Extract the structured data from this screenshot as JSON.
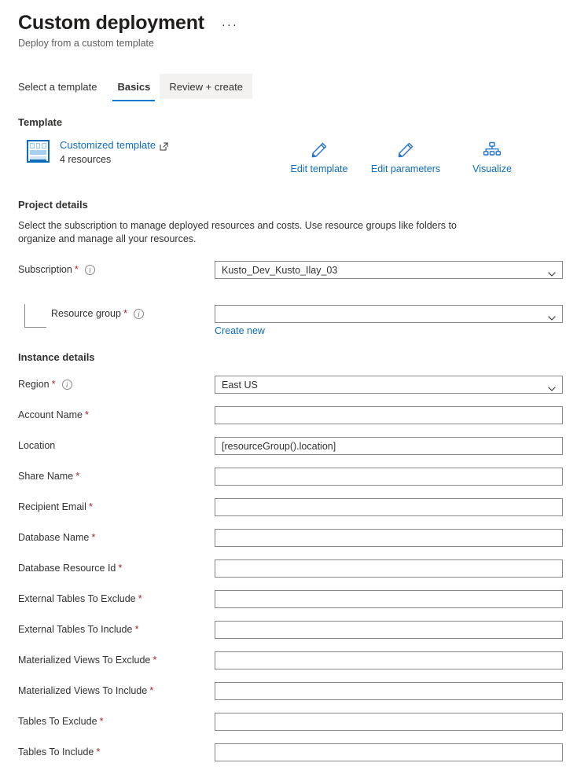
{
  "header": {
    "title": "Custom deployment",
    "subtitle": "Deploy from a custom template",
    "more_label": "···"
  },
  "tabs": [
    {
      "label": "Select a template",
      "state": "normal"
    },
    {
      "label": "Basics",
      "state": "selected"
    },
    {
      "label": "Review + create",
      "state": "hovered"
    }
  ],
  "template_section": {
    "heading": "Template",
    "link_label": "Customized template",
    "resources_label": "4 resources",
    "actions": [
      {
        "label": "Edit template",
        "icon": "pencil-icon"
      },
      {
        "label": "Edit parameters",
        "icon": "pencil-icon"
      },
      {
        "label": "Visualize",
        "icon": "hierarchy-icon"
      }
    ]
  },
  "project_details": {
    "heading": "Project details",
    "description": "Select the subscription to manage deployed resources and costs. Use resource groups like folders to organize and manage all your resources.",
    "subscription": {
      "label": "Subscription",
      "required": "*",
      "value": "Kusto_Dev_Kusto_Ilay_03",
      "has_info": true
    },
    "resource_group": {
      "label": "Resource group",
      "required": "*",
      "value": "",
      "has_info": true,
      "create_new_label": "Create new"
    }
  },
  "instance_details": {
    "heading": "Instance details",
    "fields": [
      {
        "label": "Region",
        "required": "*",
        "value": "East US",
        "type": "select",
        "has_info": true
      },
      {
        "label": "Account Name",
        "required": "*",
        "value": "",
        "type": "text",
        "has_info": false
      },
      {
        "label": "Location",
        "required": "",
        "value": "[resourceGroup().location]",
        "type": "text",
        "has_info": false
      },
      {
        "label": "Share Name",
        "required": "*",
        "value": "",
        "type": "text",
        "has_info": false
      },
      {
        "label": "Recipient Email",
        "required": "*",
        "value": "",
        "type": "text",
        "has_info": false
      },
      {
        "label": "Database Name",
        "required": "*",
        "value": "",
        "type": "text",
        "has_info": false
      },
      {
        "label": "Database Resource Id",
        "required": "*",
        "value": "",
        "type": "text",
        "has_info": false
      },
      {
        "label": "External Tables To Exclude",
        "required": "*",
        "value": "",
        "type": "text",
        "has_info": false
      },
      {
        "label": "External Tables To Include",
        "required": "*",
        "value": "",
        "type": "text",
        "has_info": false
      },
      {
        "label": "Materialized Views To Exclude",
        "required": "*",
        "value": "",
        "type": "text",
        "has_info": false
      },
      {
        "label": "Materialized Views To Include",
        "required": "*",
        "value": "",
        "type": "text",
        "has_info": false
      },
      {
        "label": "Tables To Exclude",
        "required": "*",
        "value": "",
        "type": "text",
        "has_info": false
      },
      {
        "label": "Tables To Include",
        "required": "*",
        "value": "",
        "type": "text",
        "has_info": false
      }
    ]
  },
  "colors": {
    "accent": "#0078d4",
    "link": "#0f6cbd",
    "required": "#a4262c",
    "border": "#8a8886",
    "text": "#323130",
    "subtle_text": "#605e5c",
    "tab_hover_bg": "#f3f2f1"
  }
}
